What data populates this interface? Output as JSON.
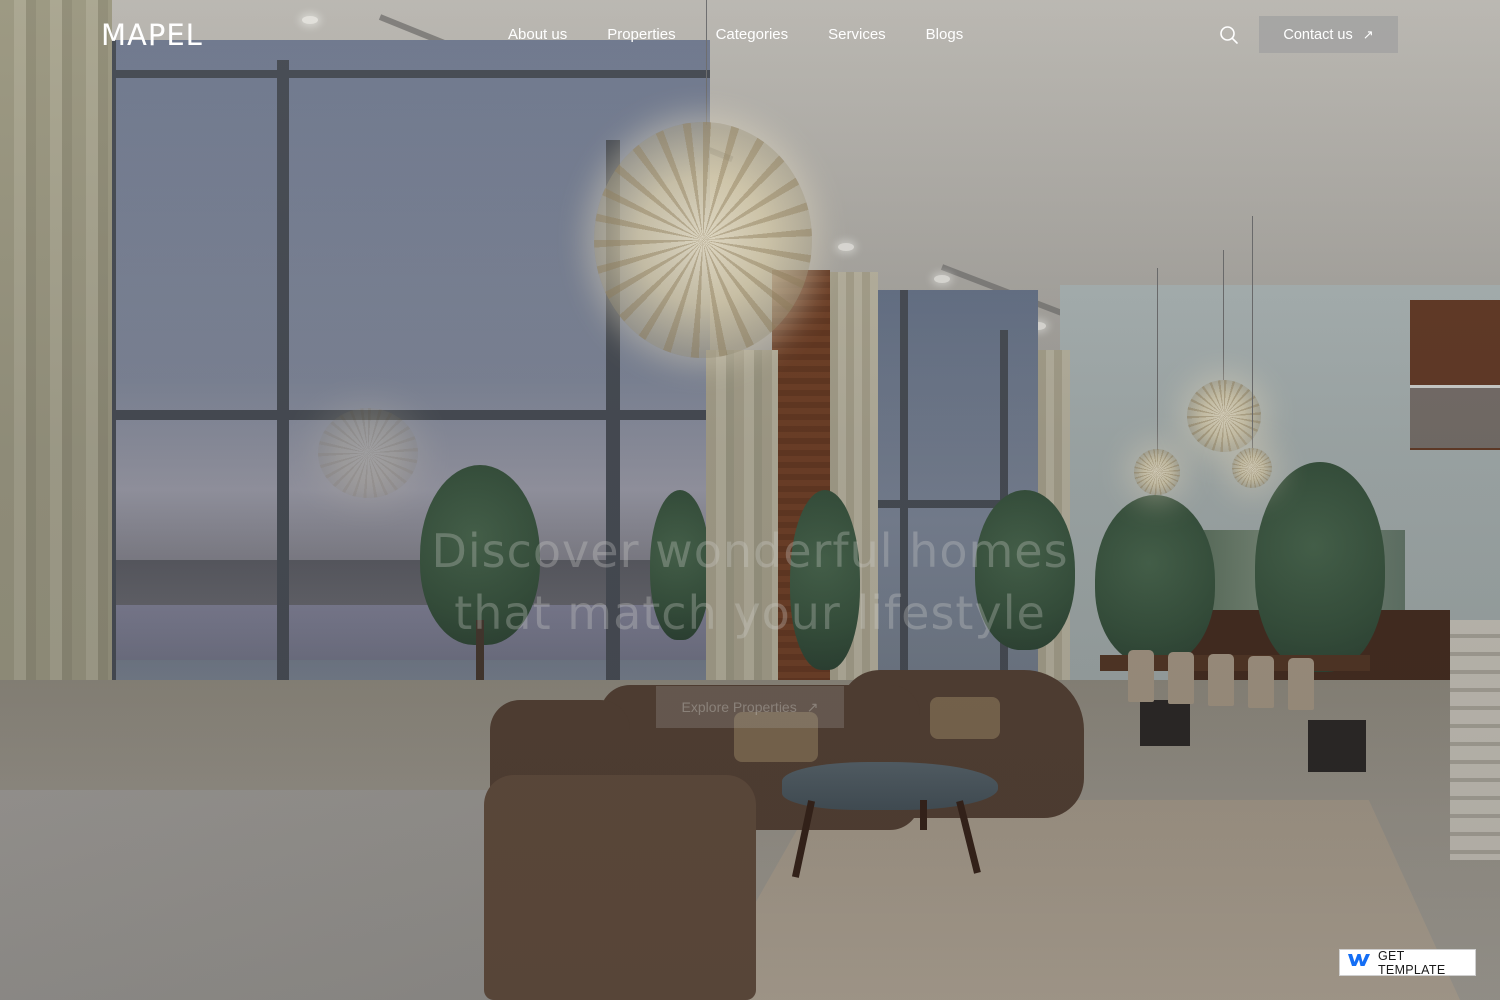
{
  "brand": {
    "logo": "MAPEL"
  },
  "nav": {
    "items": [
      {
        "label": "About us"
      },
      {
        "label": "Properties"
      },
      {
        "label": "Categories"
      },
      {
        "label": "Services"
      },
      {
        "label": "Blogs"
      }
    ]
  },
  "header": {
    "search_icon": "search-icon",
    "contact_label": "Contact us",
    "contact_icon": "arrow-up-right-icon"
  },
  "hero": {
    "headline_line1": "Discover wonderful homes",
    "headline_line2": "that match your lifestyle",
    "cta_label": "Explore Properties",
    "cta_icon": "arrow-up-right-icon"
  },
  "badge": {
    "icon": "webflow-logo-icon",
    "label": "GET TEMPLATE"
  },
  "colors": {
    "nav_text": "#ffffff",
    "contact_bg": "#a0a0a0",
    "badge_brand": "#146ef5"
  }
}
